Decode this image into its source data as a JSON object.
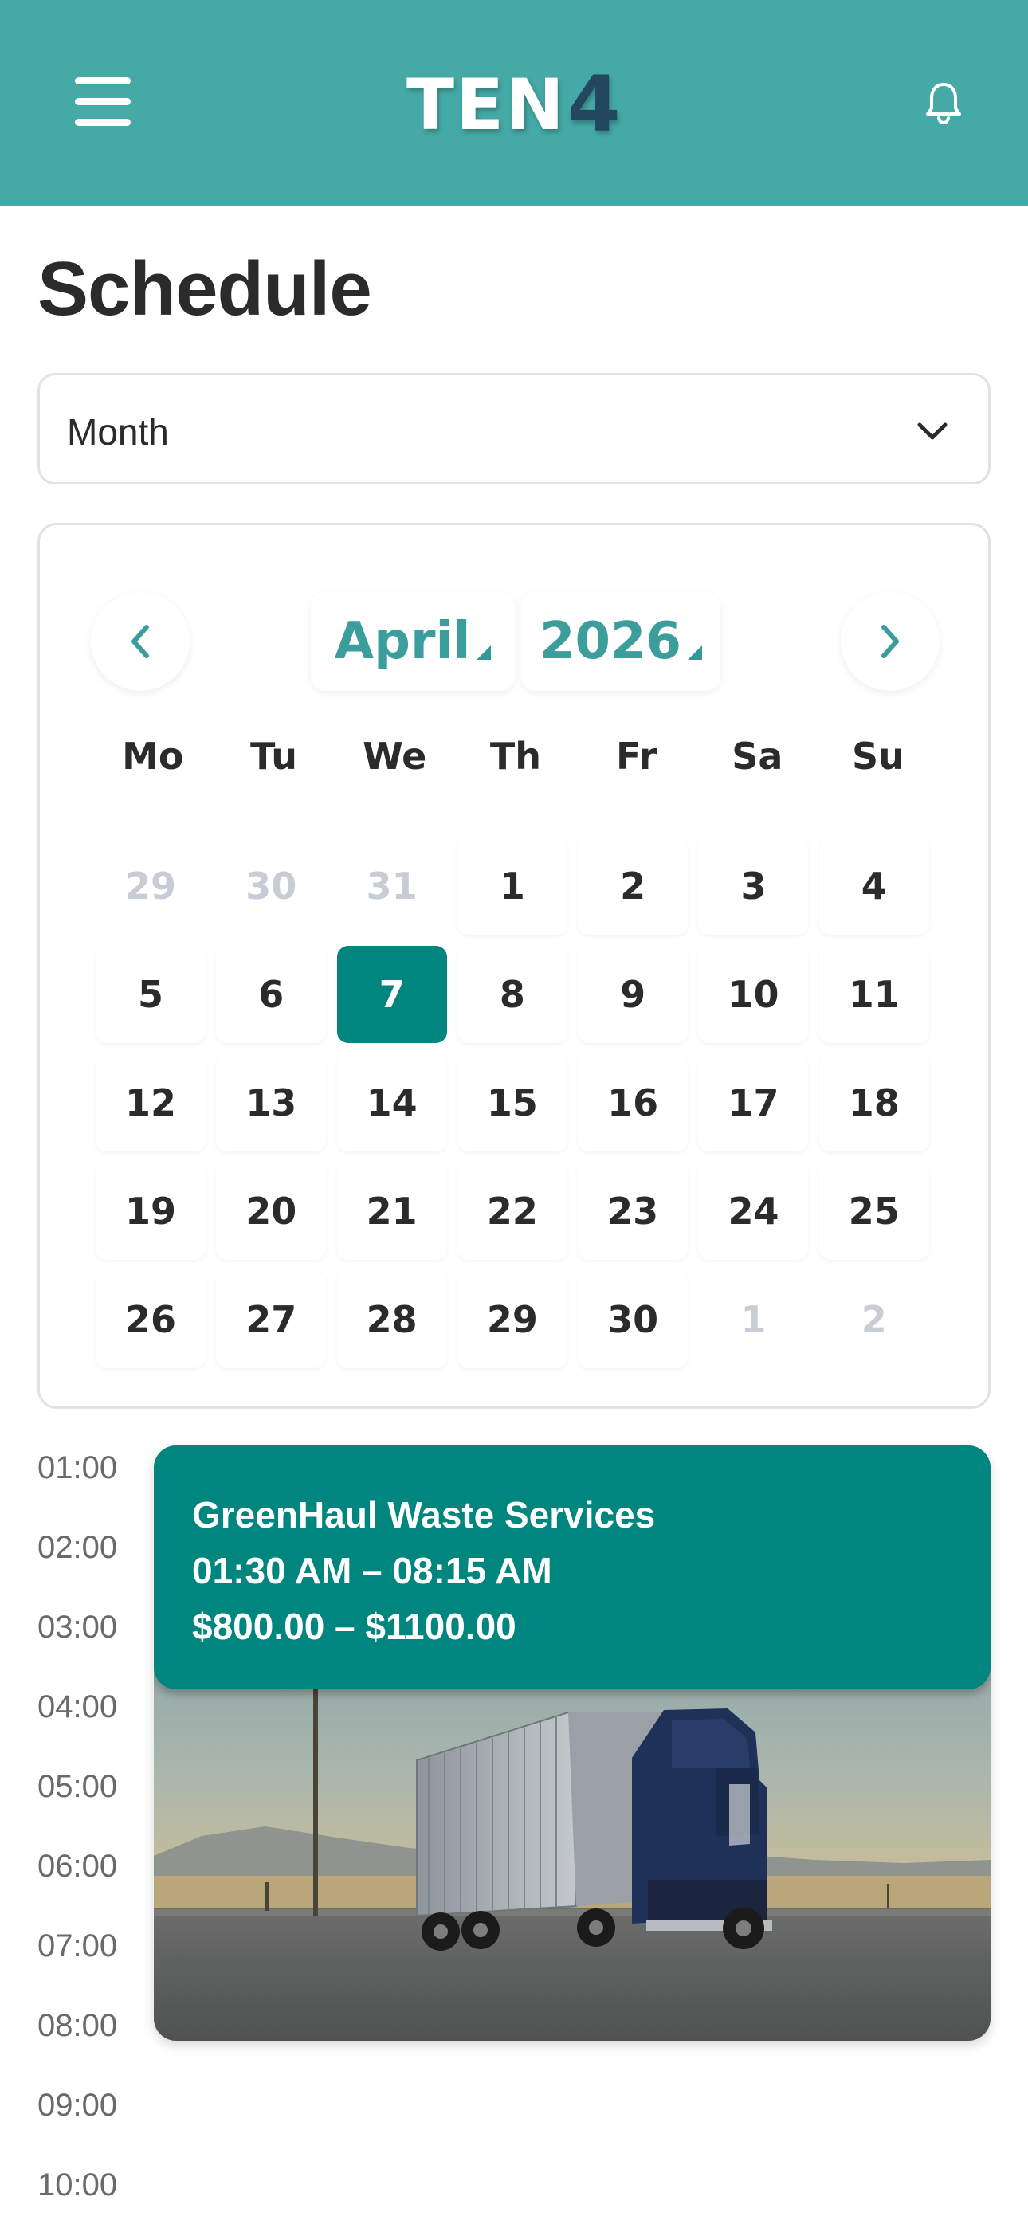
{
  "header": {
    "logo_primary": "TEN",
    "logo_accent": "4",
    "icons": {
      "menu": "hamburger-menu-icon",
      "notifications": "bell-icon"
    },
    "colors": {
      "bar": "#45a9a6",
      "logo_accent": "#22475e"
    }
  },
  "page": {
    "title": "Schedule"
  },
  "view_select": {
    "value": "Month",
    "icon": "chevron-down-icon"
  },
  "calendar": {
    "month": "April",
    "year": "2026",
    "prev_icon": "chevron-left-icon",
    "next_icon": "chevron-right-icon",
    "weekdays": [
      "Mo",
      "Tu",
      "We",
      "Th",
      "Fr",
      "Sa",
      "Su"
    ],
    "days": [
      {
        "label": "29",
        "muted": true
      },
      {
        "label": "30",
        "muted": true
      },
      {
        "label": "31",
        "muted": true
      },
      {
        "label": "1"
      },
      {
        "label": "2"
      },
      {
        "label": "3"
      },
      {
        "label": "4"
      },
      {
        "label": "5"
      },
      {
        "label": "6"
      },
      {
        "label": "7",
        "selected": true
      },
      {
        "label": "8"
      },
      {
        "label": "9"
      },
      {
        "label": "10"
      },
      {
        "label": "11"
      },
      {
        "label": "12"
      },
      {
        "label": "13"
      },
      {
        "label": "14"
      },
      {
        "label": "15"
      },
      {
        "label": "16"
      },
      {
        "label": "17"
      },
      {
        "label": "18"
      },
      {
        "label": "19"
      },
      {
        "label": "20"
      },
      {
        "label": "21"
      },
      {
        "label": "22"
      },
      {
        "label": "23"
      },
      {
        "label": "24"
      },
      {
        "label": "25"
      },
      {
        "label": "26"
      },
      {
        "label": "27"
      },
      {
        "label": "28"
      },
      {
        "label": "29"
      },
      {
        "label": "30"
      },
      {
        "label": "1",
        "muted": true
      },
      {
        "label": "2",
        "muted": true
      }
    ],
    "colors": {
      "accent": "#3b9e9c",
      "selected": "#00857f",
      "muted": "#c9ccd4"
    }
  },
  "timeline": {
    "hours": [
      "01:00",
      "02:00",
      "03:00",
      "04:00",
      "05:00",
      "06:00",
      "07:00",
      "08:00",
      "09:00",
      "10:00"
    ],
    "event": {
      "company": "GreenHaul Waste Services",
      "time": "01:30 AM – 08:15 AM",
      "price": "$800.00 – $1100.00",
      "color": "#00857f",
      "image": "semi-truck-on-road-photo"
    }
  }
}
